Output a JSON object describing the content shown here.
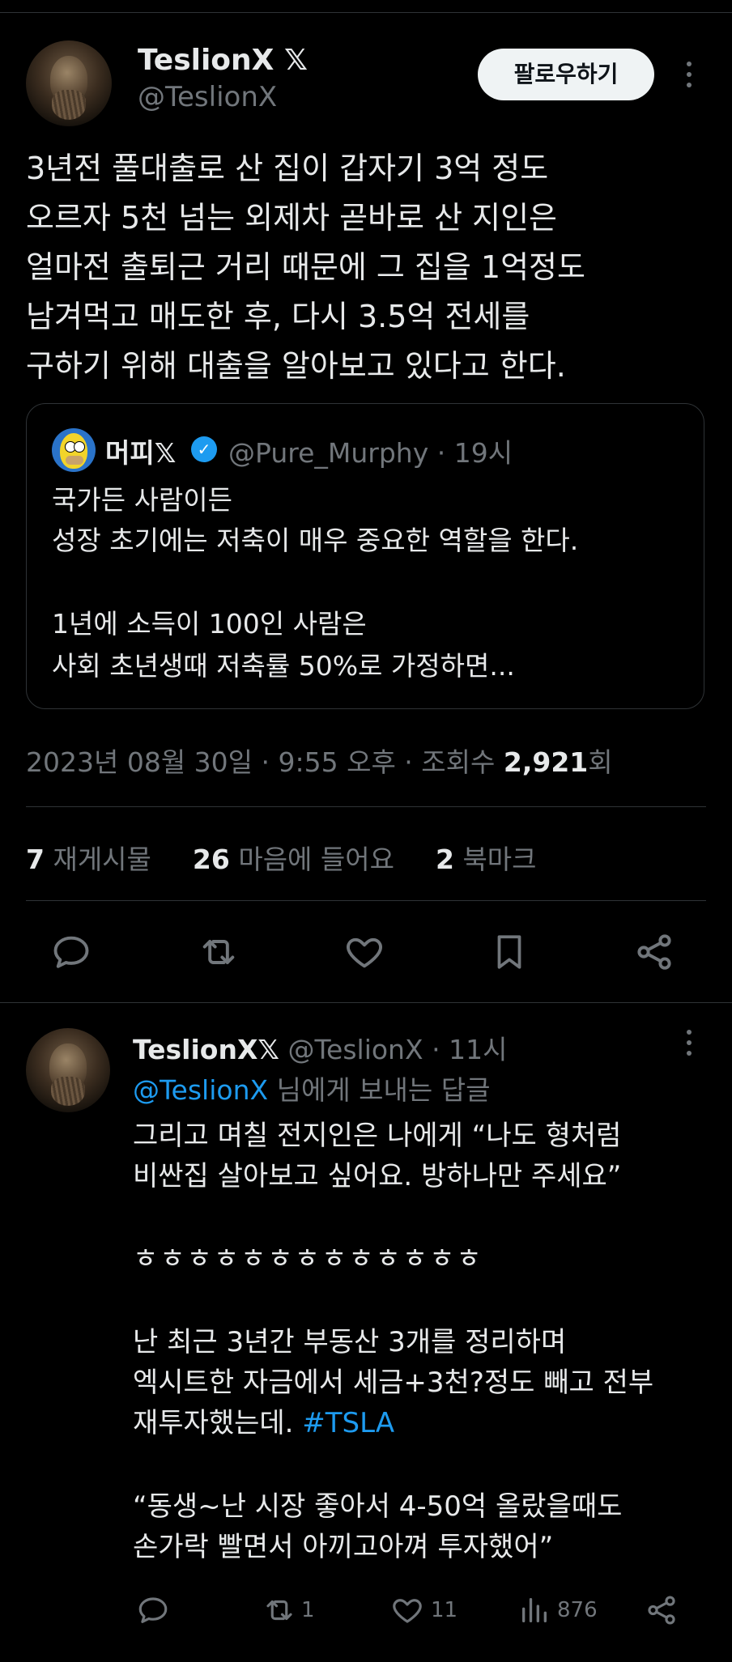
{
  "main_tweet": {
    "author_name": "TeslionX",
    "author_handle": "@TeslionX",
    "follow_label": "팔로우하기",
    "text_lines": [
      "3년전 풀대출로 산 집이 갑자기 3억 정도",
      "오르자 5천 넘는 외제차 곧바로 산 지인은",
      "얼마전 출퇴근 거리 때문에 그 집을 1억정도",
      "남겨먹고 매도한 후, 다시 3.5억 전세를",
      "구하기 위해 대출을 알아보고 있다고 한다."
    ],
    "quote": {
      "author_name": "머피",
      "author_handle": "@Pure_Murphy",
      "time": "19시",
      "text_lines": [
        "국가든 사람이든",
        "성장 초기에는 저축이 매우 중요한 역할을 한다.",
        "",
        "1년에 소득이 100인 사람은",
        "사회 초년생때 저축률 50%로 가정하면..."
      ]
    },
    "meta": {
      "date_time": "2023년 08월 30일 · 9:55 오후 · 조회수 ",
      "views": "2,921",
      "views_suffix": "회"
    },
    "stats": {
      "retweets": "7",
      "retweets_label": " 재게시물",
      "likes": "26",
      "likes_label": " 마음에 들어요",
      "bookmarks": "2",
      "bookmarks_label": " 북마크"
    }
  },
  "reply": {
    "author_name": "TeslionX",
    "author_handle": "@TeslionX",
    "time": "11시",
    "reply_to_handle": "@TeslionX",
    "reply_to_suffix": " 님에게 보내는 답글",
    "lines": [
      "그리고 며칠 전지인은 나에게 “나도 형처럼",
      "비싼집 살아보고 싶어요. 방하나만 주세요”",
      "",
      "ㅎㅎㅎㅎㅎㅎㅎㅎㅎㅎㅎㅎㅎ",
      "",
      "난 최근 3년간 부동산 3개를 정리하며",
      "엑시트한 자금에서 세금+3천?정도 빼고 전부",
      "재투자했는데. ",
      "",
      "“동생~난 시장 좋아서 4-50억 올랐을때도",
      "손가락 빨면서 아끼고아껴 투자했어”"
    ],
    "hashtag": "#TSLA",
    "counts": {
      "retweets": "1",
      "likes": "11",
      "views": "876"
    }
  },
  "icons": {
    "x_logo": "x-logo-icon",
    "verified": "verified-badge-icon",
    "more": "more-options-icon",
    "reply": "reply-icon",
    "retweet": "retweet-icon",
    "like": "heart-icon",
    "bookmark": "bookmark-icon",
    "share": "share-icon",
    "views": "views-chart-icon"
  },
  "colors": {
    "background": "#000000",
    "text": "#e7e9ea",
    "muted": "#71767b",
    "link": "#1d9bf0",
    "divider": "#2f3336"
  }
}
